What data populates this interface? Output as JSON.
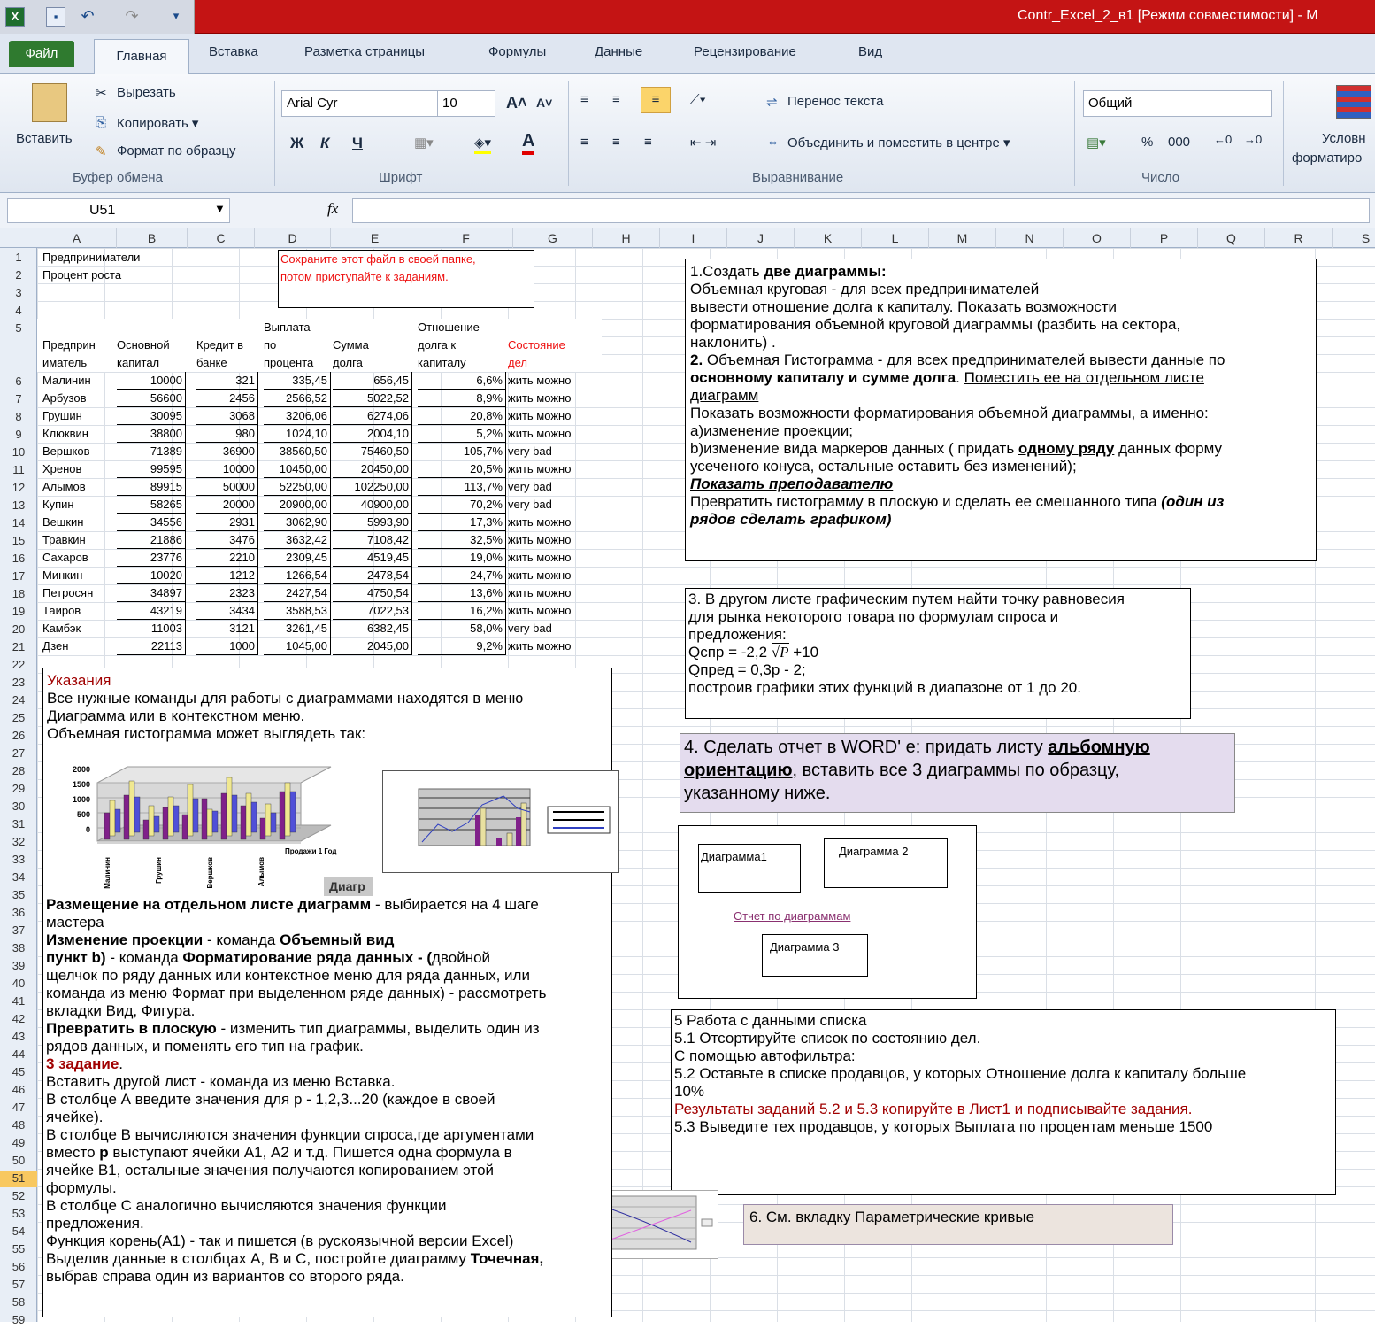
{
  "window": {
    "title": "Contr_Excel_2_в1  [Режим совместимости]  -  M"
  },
  "tabs": {
    "file": "Файл",
    "home": "Главная",
    "insert": "Вставка",
    "layout": "Разметка страницы",
    "formulas": "Формулы",
    "data": "Данные",
    "review": "Рецензирование",
    "view": "Вид"
  },
  "ribbon": {
    "paste": "Вставить",
    "cut": "Вырезать",
    "copy": "Копировать ▾",
    "format_painter": "Формат по образцу",
    "clipboard_group": "Буфер обмена",
    "font_name": "Arial Cyr",
    "font_size": "10",
    "bold": "Ж",
    "italic": "К",
    "underline": "Ч",
    "font_group": "Шрифт",
    "wrap": "Перенос текста",
    "merge": "Объединить и поместить в центре ▾",
    "align_group": "Выравнивание",
    "number_format": "Общий",
    "percent": "%",
    "thousands": "000",
    "number_group": "Число",
    "cond_format_1": "Условн",
    "cond_format_2": "форматиро"
  },
  "formula_bar": {
    "name_box": "U51",
    "fx": "fx",
    "value": ""
  },
  "columns": [
    "A",
    "B",
    "C",
    "D",
    "E",
    "F",
    "G",
    "H",
    "I",
    "J",
    "K",
    "L",
    "M",
    "N",
    "O",
    "P",
    "Q",
    "R",
    "S"
  ],
  "rows": [
    "1",
    "2",
    "3",
    "4",
    "5",
    "6",
    "7",
    "8",
    "9",
    "10",
    "11",
    "12",
    "13",
    "14",
    "15",
    "16",
    "17",
    "18",
    "19",
    "20",
    "21",
    "22",
    "23",
    "24",
    "25",
    "26",
    "27",
    "28",
    "29",
    "30",
    "31",
    "32",
    "33",
    "34",
    "35",
    "36",
    "37",
    "38",
    "39",
    "40",
    "41",
    "42",
    "43",
    "44",
    "45",
    "46",
    "47",
    "48",
    "49",
    "50",
    "51",
    "52",
    "53",
    "54",
    "55",
    "56",
    "57",
    "58",
    "59"
  ],
  "sheet": {
    "a1": "Предприниматели",
    "a2": "Процент роста",
    "note1": "Сохраните этот файл в своей папке,",
    "note2": "потом приступайте к заданиям.",
    "h_a": [
      "Предприн",
      "иматель"
    ],
    "h_b": [
      "Основной",
      "капитал"
    ],
    "h_c": [
      "Кредит в",
      "банке"
    ],
    "h_d": [
      "Выплата",
      "по",
      "процента"
    ],
    "h_e": [
      "Сумма",
      "долга"
    ],
    "h_f": [
      "Отношение",
      "долга к",
      "капиталу"
    ],
    "h_g": [
      "Состояние",
      "дел"
    ],
    "table": [
      [
        "Малинин",
        "10000",
        "321",
        "335,45",
        "656,45",
        "6,6%",
        "жить можно"
      ],
      [
        "Арбузов",
        "56600",
        "2456",
        "2566,52",
        "5022,52",
        "8,9%",
        "жить можно"
      ],
      [
        "Грушин",
        "30095",
        "3068",
        "3206,06",
        "6274,06",
        "20,8%",
        "жить можно"
      ],
      [
        "Клюквин",
        "38800",
        "980",
        "1024,10",
        "2004,10",
        "5,2%",
        "жить можно"
      ],
      [
        "Вершков",
        "71389",
        "36900",
        "38560,50",
        "75460,50",
        "105,7%",
        "very bad"
      ],
      [
        "Хренов",
        "99595",
        "10000",
        "10450,00",
        "20450,00",
        "20,5%",
        "жить можно"
      ],
      [
        "Алымов",
        "89915",
        "50000",
        "52250,00",
        "102250,00",
        "113,7%",
        "very bad"
      ],
      [
        "Купин",
        "58265",
        "20000",
        "20900,00",
        "40900,00",
        "70,2%",
        "very bad"
      ],
      [
        "Вешкин",
        "34556",
        "2931",
        "3062,90",
        "5993,90",
        "17,3%",
        "жить можно"
      ],
      [
        "Травкин",
        "21886",
        "3476",
        "3632,42",
        "7108,42",
        "32,5%",
        "жить можно"
      ],
      [
        "Сахаров",
        "23776",
        "2210",
        "2309,45",
        "4519,45",
        "19,0%",
        "жить можно"
      ],
      [
        "Минкин",
        "10020",
        "1212",
        "1266,54",
        "2478,54",
        "24,7%",
        "жить можно"
      ],
      [
        "Петросян",
        "34897",
        "2323",
        "2427,54",
        "4750,54",
        "13,6%",
        "жить можно"
      ],
      [
        "Таиров",
        "43219",
        "3434",
        "3588,53",
        "7022,53",
        "16,2%",
        "жить можно"
      ],
      [
        "Камбэк",
        "11003",
        "3121",
        "3261,45",
        "6382,45",
        "58,0%",
        "very bad"
      ],
      [
        "Дзен",
        "22113",
        "1000",
        "1045,00",
        "2045,00",
        "9,2%",
        "жить можно"
      ]
    ]
  },
  "task1": {
    "l1a": "1.Создать ",
    "l1b": "две диаграммы:",
    "l2": "Объемная круговая - для всех предпринимателей",
    "l3": "вывести  отношение долга к капиталу.  Показать  возможности",
    "l4": "форматирования объемной  круговой диаграммы (разбить на сектора,",
    "l5": "наклонить) .",
    "l6a": " 2. ",
    "l6b": "Объемная Гистограмма - для всех  предпринимателей вывести данные по",
    "l7a": "основному  капиталу  и сумме долга",
    "l7b": ". ",
    "l7c": "Поместить ее на отдельном листе",
    "l8": "диаграмм",
    "l9": " Показать возможности форматирования объемной диаграммы, а именно:",
    "l10": "а)изменение проекции;",
    "l11a": "b)изменение вида маркеров данных ( придать  ",
    "l11b": "одному  ряду",
    "l11c": " данных форму",
    "l12": "усеченого конуса, остальные оставить без изменений);",
    "l13": "Показать преподавателю",
    "l14a": "Превратить гистограмму в плоскую и сделать ее смешанного типа ",
    "l14b": "(один из",
    "l15": "рядов  сделать графиком)"
  },
  "task3": {
    "l1": "3. В другом листе графическим путем найти точку равновесия",
    "l2": "для рынка некоторого товара по формулам спроса и",
    "l3": "предложения:",
    "l4a": "Qспр = -2,2  ",
    "l4b": "P",
    "l4c": "   +10",
    "l5": "Qпред  = 0,3р - 2;",
    "l6": "построив графики этих  функций в диапазоне  от 1 до 20."
  },
  "task4": {
    "l1a": "4.  Сделать отчет в WORD' е:  придать листу ",
    "l1b": "альбомную",
    "l2a": "ориентацию",
    "l2b": ", вставить все 3 диаграммы по образцу,",
    "l3": "указанному ниже."
  },
  "diagrams": {
    "d1": "Диаграмма1",
    "d2": "Диаграмма 2",
    "report": "Отчет по диаграммам",
    "d3": "Диаграмма 3"
  },
  "task5": {
    "l1": "5  Работа с данными списка",
    "l2": "5.1 Отсортируйте  список по состоянию дел.",
    "l3": "С помощью автофильтра:",
    "l4": "5.2 Оставьте  в списке продавцов, у  которых Отношение долга к капиталу больше",
    "l5": "10%",
    "l6": "Результаты заданий 5.2 и 5.3 копируйте в Лист1 и подписывайте задания.",
    "l7": "5.3 Выведите тех продавцов, у которых Выплата по процентам меньше 1500"
  },
  "task6": {
    "l1": "6. См. вкладку  Параметрические кривые"
  },
  "instructions": {
    "title": "Указания",
    "l1": "Все нужные команды для работы с диаграммами находятся в меню",
    "l2": "Диаграмма или в контекстном меню.",
    "l3": "Объемная гистограмма может выглядеть так:",
    "chart_y": [
      "2000",
      "1500",
      "1000",
      "500",
      "0"
    ],
    "chart_x": [
      "Малинин",
      "Грушин",
      "Вершков",
      "Алымов"
    ],
    "chart_series": "Продажи 1 Год",
    "chart_btn": "Диагр",
    "l4a": "Размещение на отдельном листе диаграмм",
    "l4b": " - выбирается на 4 шаге",
    "l5": "мастера",
    "l6a": "Изменение  проекции",
    "l6b": " - команда ",
    "l6c": "Объемный вид",
    "l7a": "пункт b)",
    "l7b": " - команда ",
    "l7c": "Форматирование  ряда данных",
    "l7d": "  - (",
    "l7e": "двойной",
    "l8": "щелчок по ряду данных или контекстное меню для ряда данных, или",
    "l9": "команда из меню Формат при выделенном ряде данных) - рассмотреть",
    "l10": "вкладки Вид, Фигура.",
    "l11a": "Превратить  в плоскую",
    "l11b": " - изменить тип диаграммы, выделить один из",
    "l12": "рядов данных, и поменять его тип на график.",
    "l13a": "3 задание",
    "l13b": ".",
    "l14": "Вставить другой лист - команда из меню Вставка.",
    "l15": "В столбце А  введите значения для р - 1,2,3...20 (каждое в своей",
    "l16": "ячейке).",
    "l17": "В столбце В вычисляются значения функции спроса,где аргументами",
    "l18a": "вместо ",
    "l18b": "р",
    "l18c": " выступают  ячейки А1, А2 и т.д. Пишется одна формула в",
    "l19": "ячейке В1, остальные значения получаются копированием этой",
    "l20": "формулы.",
    "l21": "В столбце С аналогично вычисляются значения функции",
    "l22": "предложения.",
    "l23": "Функция  корень(А1) - так и пишется (в рускоязычной версии Excel)",
    "l24a": "Выделив данные в столбцах А,  В и С, постройте диаграмму ",
    "l24b": "Точечная,",
    "l25": "выбрав справа один из вариантов со второго  ряда."
  },
  "colors": {
    "title_bar": "#c41414",
    "file_tab": "#2f7a2f",
    "red_text": "#cc0000",
    "dark_red": "#a00000",
    "task4_bg": "#e4dcee",
    "task6_bg": "#ece4de"
  }
}
